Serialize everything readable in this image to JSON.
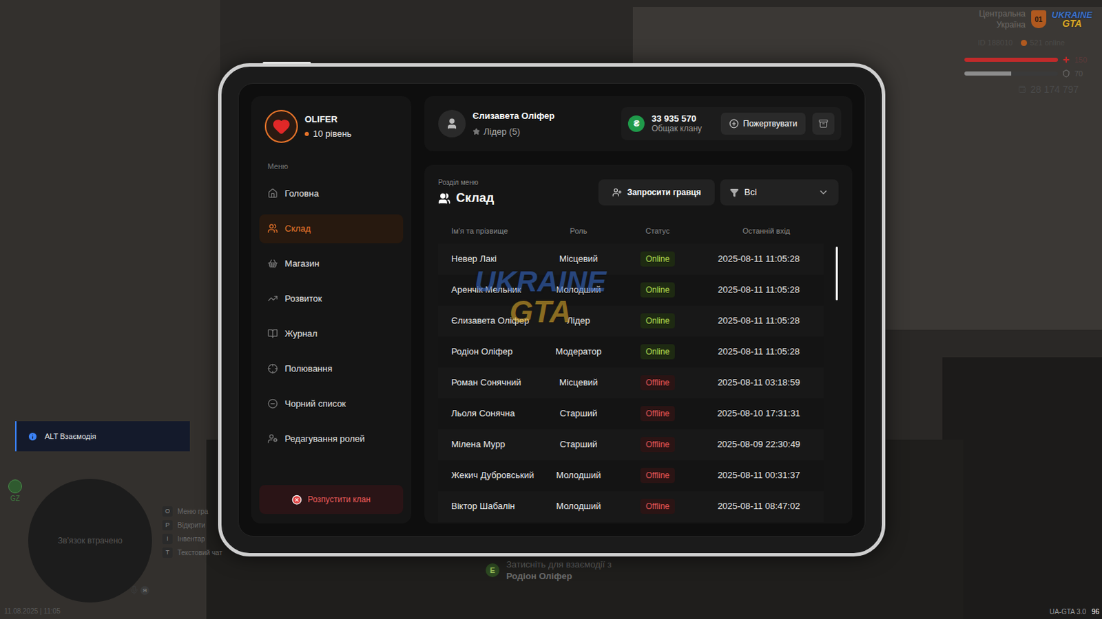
{
  "hud": {
    "region_lines": [
      "Центральна",
      "Україна"
    ],
    "region_badge": "01",
    "logo_top": "UKRAINE",
    "logo_bottom": "GTA",
    "player_id": "ID 188010",
    "online": "521 online",
    "health": {
      "level": 1,
      "reading": "150"
    },
    "armor": {
      "level": 0.5,
      "reading": "70"
    },
    "money": "28 174 797"
  },
  "hint": {
    "text": "ALT Взаємодія"
  },
  "minimap": {
    "status": "Зв'язок втрачено",
    "zone": "GZ",
    "voice": "Я"
  },
  "keys": [
    {
      "key": "O",
      "label": "Меню гра"
    },
    {
      "key": "P",
      "label": "Відкрити"
    },
    {
      "key": "I",
      "label": "Інвентар"
    },
    {
      "key": "T",
      "label": "Текстовий чат"
    }
  ],
  "interaction": {
    "key": "E",
    "text": "Затисніть для взаємодії з",
    "target": "Родіон Оліфер"
  },
  "datetime": "11.08.2025 | 11:05",
  "version": "UA-GTA 3.0",
  "fps": "96",
  "clan": {
    "name": "OLIFER",
    "level": "10 рівень"
  },
  "menu": {
    "heading": "Меню",
    "items": [
      {
        "label": "Головна",
        "selected": false
      },
      {
        "label": "Склад",
        "selected": true
      },
      {
        "label": "Магазин",
        "selected": false
      },
      {
        "label": "Розвиток",
        "selected": false
      },
      {
        "label": "Журнал",
        "selected": false
      },
      {
        "label": "Полювання",
        "selected": false
      },
      {
        "label": "Чорний список",
        "selected": false
      },
      {
        "label": "Редагування ролей",
        "selected": false
      }
    ]
  },
  "disband_button": "Розпустити клан",
  "user": {
    "name": "Єлизавета Оліфер",
    "rank": "Лідер (5)"
  },
  "treasury": {
    "currency": "₴",
    "amount": "33 935 570",
    "label": "Общак клану",
    "donate": "Пожертвувати"
  },
  "section": {
    "caption": "Розділ меню",
    "title": "Склад",
    "invite": "Запросити гравця",
    "filter": "Всі"
  },
  "table": {
    "columns": [
      "Ім'я та прізвище",
      "Роль",
      "Статус",
      "Останній вхід"
    ],
    "rows": [
      {
        "name": "Невер Лакі",
        "role": "Місцевий",
        "status": "Online",
        "online": true,
        "last": "2025-08-11 11:05:28"
      },
      {
        "name": "Аренчік Мельник",
        "role": "Молодший",
        "status": "Online",
        "online": true,
        "last": "2025-08-11 11:05:28"
      },
      {
        "name": "Єлизавета Оліфер",
        "role": "Лідер",
        "status": "Online",
        "online": true,
        "last": "2025-08-11 11:05:28"
      },
      {
        "name": "Родіон Оліфер",
        "role": "Модератор",
        "status": "Online",
        "online": true,
        "last": "2025-08-11 11:05:28"
      },
      {
        "name": "Роман Сонячний",
        "role": "Місцевий",
        "status": "Offline",
        "online": false,
        "last": "2025-08-11 03:18:59"
      },
      {
        "name": "Льоля Сонячна",
        "role": "Старший",
        "status": "Offline",
        "online": false,
        "last": "2025-08-10 17:31:31"
      },
      {
        "name": "Мілена Мурр",
        "role": "Старший",
        "status": "Offline",
        "online": false,
        "last": "2025-08-09 22:30:49"
      },
      {
        "name": "Жекич Дубровський",
        "role": "Молодший",
        "status": "Offline",
        "online": false,
        "last": "2025-08-11 00:31:37"
      },
      {
        "name": "Віктор Шабалін",
        "role": "Молодший",
        "status": "Offline",
        "online": false,
        "last": "2025-08-11 08:47:02"
      }
    ]
  },
  "watermark": {
    "top": "UKRAINE",
    "bottom": "GTA"
  }
}
